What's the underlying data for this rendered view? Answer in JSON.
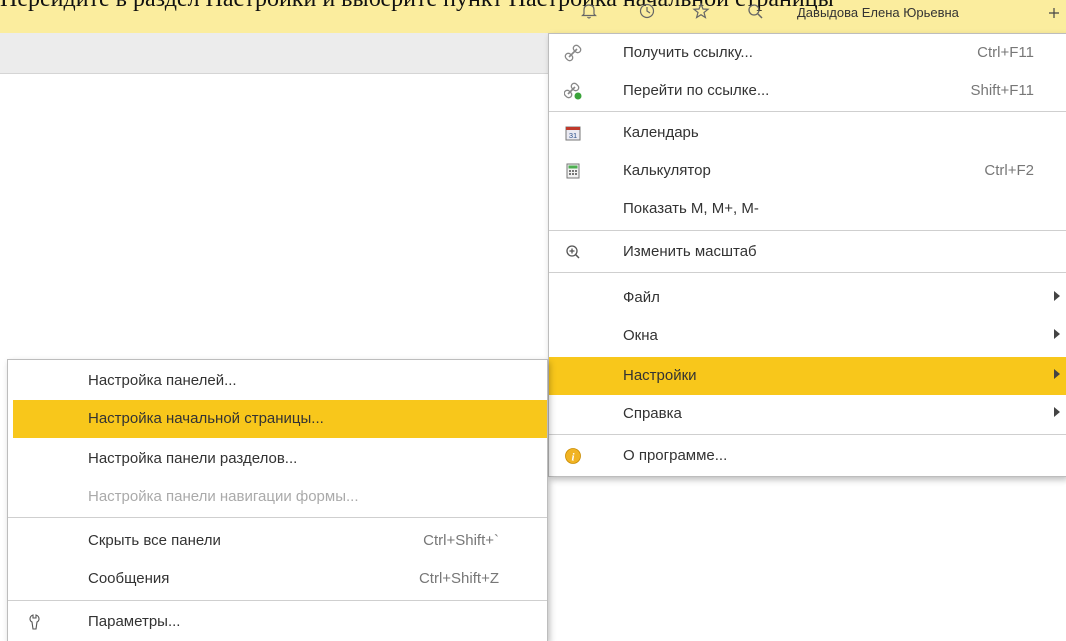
{
  "top": {
    "cut_text": "Перейдите в раздел Настройки и выберите пункт Настройка начальной страницы",
    "user_name": "Давыдова Елена Юрьевна",
    "icons": [
      "bell-icon",
      "history-icon",
      "star-icon",
      "search-icon"
    ]
  },
  "main_menu": {
    "items": [
      {
        "label": "Получить ссылку...",
        "shortcut": "Ctrl+F11",
        "icon": "link-icon"
      },
      {
        "label": "Перейти по ссылке...",
        "shortcut": "Shift+F11",
        "icon": "link-go-icon"
      },
      {
        "label": "Календарь",
        "shortcut": "",
        "icon": "calendar-icon",
        "icon_text": "31"
      },
      {
        "label": "Калькулятор",
        "shortcut": "Ctrl+F2",
        "icon": "calculator-icon"
      },
      {
        "label": "Показать M, M+, M-",
        "shortcut": ""
      },
      {
        "label": "Изменить масштаб",
        "shortcut": "",
        "icon": "zoom-icon"
      },
      {
        "label": "Файл",
        "submenu": true
      },
      {
        "label": "Окна",
        "submenu": true
      },
      {
        "label": "Настройки",
        "submenu": true,
        "highlighted": true
      },
      {
        "label": "Справка",
        "submenu": true
      },
      {
        "label": "О программе...",
        "icon": "info-icon"
      }
    ]
  },
  "sub_menu": {
    "items": [
      {
        "label": "Настройка панелей..."
      },
      {
        "label": "Настройка начальной страницы...",
        "highlighted": true
      },
      {
        "label": "Настройка панели разделов..."
      },
      {
        "label": "Настройка панели навигации формы...",
        "disabled": true
      },
      {
        "label": "Скрыть все панели",
        "shortcut": "Ctrl+Shift+`"
      },
      {
        "label": "Сообщения",
        "shortcut": "Ctrl+Shift+Z"
      },
      {
        "label": "Параметры...",
        "icon": "wrench-icon"
      }
    ]
  },
  "colors": {
    "highlight": "#f8c71b",
    "topbar": "#fbed9e",
    "disabled_text": "#aaaaaa"
  }
}
